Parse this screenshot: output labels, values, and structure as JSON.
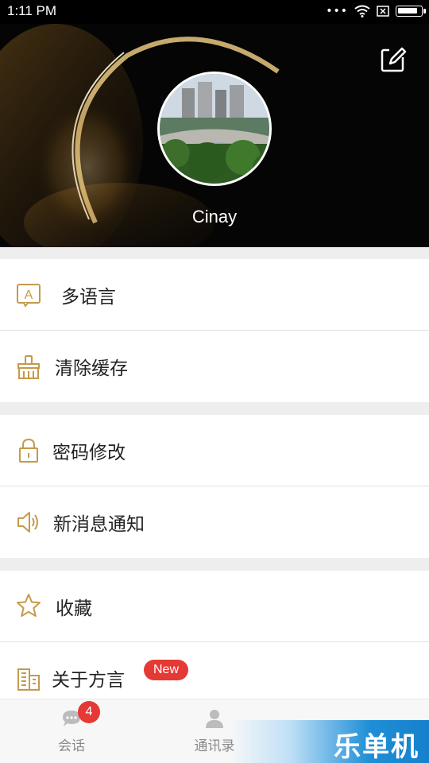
{
  "status_bar": {
    "time": "1:11 PM",
    "icons": [
      "more-dots-icon",
      "wifi-icon",
      "sim-icon",
      "battery-icon"
    ],
    "battery_level": 0.9
  },
  "profile": {
    "username": "Cinay",
    "edit_icon": "edit-icon",
    "avatar": "avatar-photo"
  },
  "menu": {
    "group1": [
      {
        "label": "多语言",
        "icon": "language-icon"
      },
      {
        "label": "清除缓存",
        "icon": "broom-icon"
      }
    ],
    "group2": [
      {
        "label": "密码修改",
        "icon": "lock-icon"
      },
      {
        "label": "新消息通知",
        "icon": "speaker-icon"
      }
    ],
    "group3": [
      {
        "label": "收藏",
        "icon": "star-icon"
      },
      {
        "label": "关于方言",
        "icon": "building-icon",
        "badge": "New"
      }
    ]
  },
  "bottom_nav": {
    "items": [
      {
        "label": "会话",
        "icon": "chat-icon",
        "badge": "4"
      },
      {
        "label": "通讯录",
        "icon": "contacts-icon"
      }
    ]
  },
  "watermark": {
    "text": "乐单机"
  },
  "colors": {
    "accent_icon": "#c49a4a",
    "badge_red": "#e53935",
    "header_bg": "#050505"
  }
}
